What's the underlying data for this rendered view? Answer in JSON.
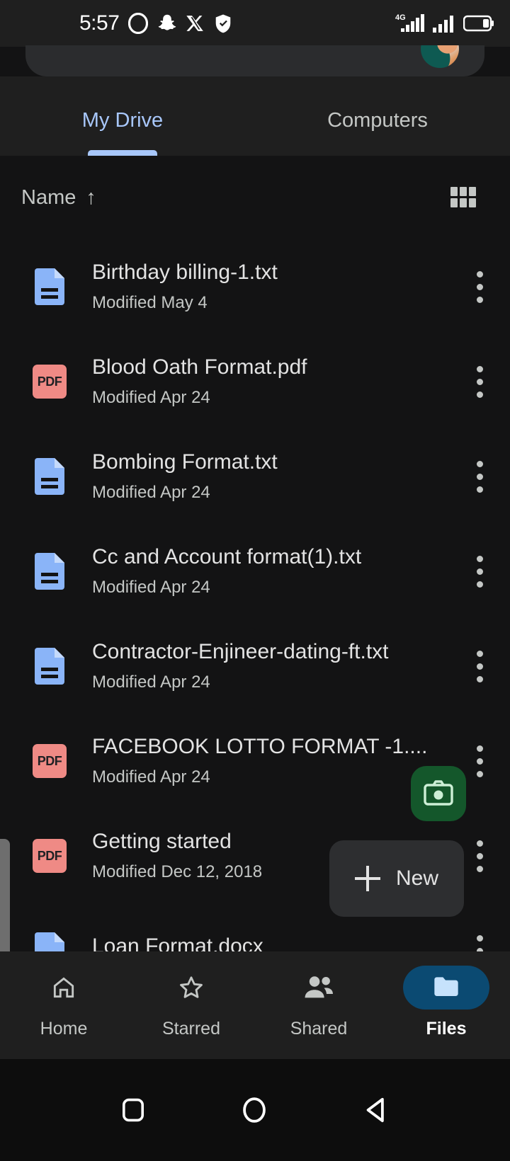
{
  "statusbar": {
    "time": "5:57",
    "icons": [
      "opera-icon",
      "snapchat-icon",
      "x-icon",
      "shield-icon"
    ],
    "network": "4G",
    "signal_icon": "signal-bars-icon",
    "battery_icon": "battery-icon"
  },
  "search": {
    "placeholder": "",
    "avatar": "account-avatar"
  },
  "tabs": [
    {
      "label": "My Drive",
      "active": true
    },
    {
      "label": "Computers",
      "active": false
    }
  ],
  "toolbar": {
    "sort_label": "Name",
    "sort_arrow": "↑",
    "view_toggle_icon": "grid-view-icon"
  },
  "files": [
    {
      "name": "Birthday billing-1.txt",
      "modified": "Modified May 4",
      "icon": "doc"
    },
    {
      "name": "Blood Oath Format.pdf",
      "modified": "Modified Apr 24",
      "icon": "pdf"
    },
    {
      "name": "Bombing Format.txt",
      "modified": "Modified Apr 24",
      "icon": "doc"
    },
    {
      "name": "Cc and Account format(1).txt",
      "modified": "Modified Apr 24",
      "icon": "doc"
    },
    {
      "name": "Contractor-Enjineer-dating-ft.txt",
      "modified": "Modified Apr 24",
      "icon": "doc"
    },
    {
      "name": "FACEBOOK LOTTO FORMAT -1....",
      "modified": "Modified Apr 24",
      "icon": "pdf"
    },
    {
      "name": "Getting started",
      "modified": "Modified Dec 12, 2018",
      "icon": "pdf"
    },
    {
      "name": "Loan Format.docx",
      "modified": "",
      "icon": "doc"
    }
  ],
  "pdf_badge": "PDF",
  "fabs": {
    "camera_label": "camera-icon",
    "new_label": "New"
  },
  "bottom_nav": [
    {
      "label": "Home",
      "icon": "home-icon",
      "active": false
    },
    {
      "label": "Starred",
      "icon": "star-icon",
      "active": false
    },
    {
      "label": "Shared",
      "icon": "people-icon",
      "active": false
    },
    {
      "label": "Files",
      "icon": "folder-icon",
      "active": true
    }
  ],
  "system_nav": [
    {
      "icon": "recents-square-icon"
    },
    {
      "icon": "home-circle-icon"
    },
    {
      "icon": "back-triangle-icon"
    }
  ],
  "colors": {
    "accent_blue": "#A8C7FA",
    "doc_icon": "#8AB4F8",
    "pdf_icon": "#EF8A85",
    "camera_fab": "#14572B",
    "active_nav_pill": "#0B4A72",
    "surface": "#1F1F1F",
    "list_bg": "#131314"
  }
}
